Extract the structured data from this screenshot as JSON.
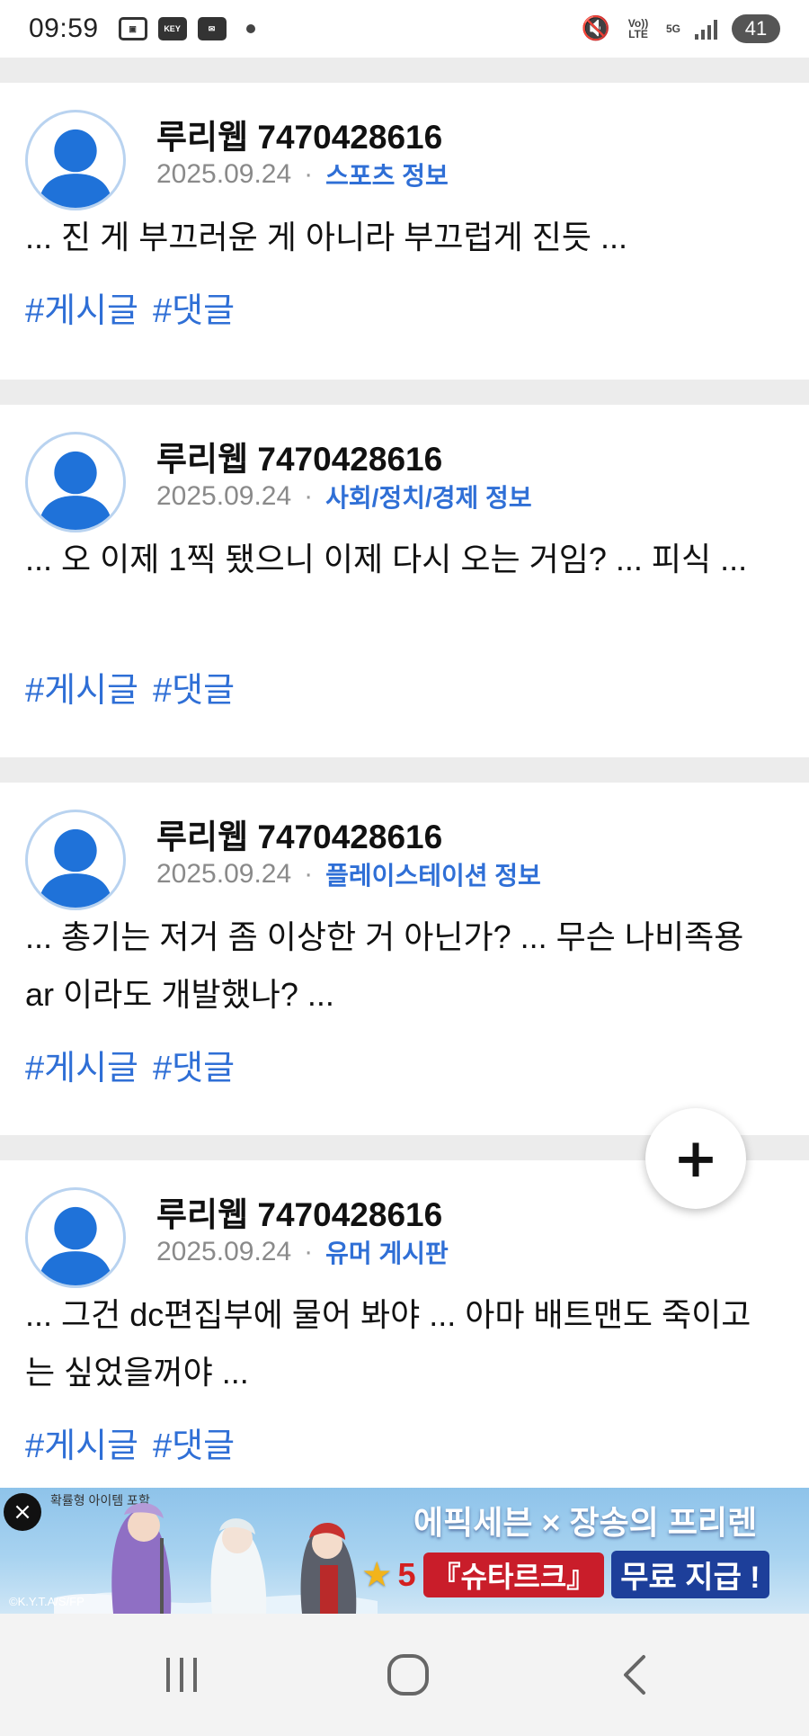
{
  "status_bar": {
    "time": "09:59",
    "icons_left": [
      "gallery-icon",
      "key-icon",
      "mail-icon",
      "dot-icon"
    ],
    "key_label": "KEY",
    "volte_label": "Vo)) LTE",
    "network_label": "5G",
    "battery": "41"
  },
  "posts": [
    {
      "author": "루리웹 7470428616",
      "date": "2025.09.24",
      "separator": "·",
      "board": "스포츠 정보",
      "excerpt": "... 진 게 부끄러운 게 아니라 부끄럽게 진듯 ...",
      "tags": [
        "#게시글",
        "#댓글"
      ]
    },
    {
      "author": "루리웹 7470428616",
      "date": "2025.09.24",
      "separator": "·",
      "board": "사회/정치/경제 정보",
      "excerpt": "... 오 이제 1찍 됐으니 이제 다시 오는 거임? ... 피식 ...",
      "tags": [
        "#게시글",
        "#댓글"
      ]
    },
    {
      "author": "루리웹 7470428616",
      "date": "2025.09.24",
      "separator": "·",
      "board": "플레이스테이션 정보",
      "excerpt": "... 총기는 저거 좀 이상한 거 아닌가? ... 무슨 나비족용 ar 이라도 개발했나? ...",
      "tags": [
        "#게시글",
        "#댓글"
      ]
    },
    {
      "author": "루리웹 7470428616",
      "date": "2025.09.24",
      "separator": "·",
      "board": "유머 게시판",
      "excerpt": "... 그건 dc편집부에 물어 봐야 ... 아마 배트맨도 죽이고는 싶었을꺼야 ...",
      "tags": [
        "#게시글",
        "#댓글"
      ]
    }
  ],
  "fab": {
    "label": "+"
  },
  "ad": {
    "close": "×",
    "note": "확률형 아이템 포함",
    "headline": "에픽세븐 × 장송의 프리렌",
    "star": "★",
    "number": "5",
    "item": "『슈타르크』",
    "offer": "무료 지급 !",
    "copyright": "©K.Y.T.A/S/FP"
  },
  "colors": {
    "accent": "#2f6fd6",
    "avatar": "#1f72d9",
    "divider": "#ececec"
  },
  "nav_bar": {
    "buttons": [
      "recent-apps-icon",
      "home-icon",
      "back-icon"
    ]
  }
}
